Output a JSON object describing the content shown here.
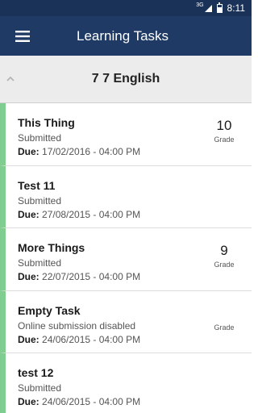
{
  "status_bar": {
    "network": "3G",
    "time": "8:11"
  },
  "app_bar": {
    "title": "Learning Tasks",
    "menu_icon": "hamburger-menu-icon"
  },
  "course": {
    "title": "7 7 English",
    "collapse_icon": "chevron-up-icon"
  },
  "accent_color": "#7fce8f",
  "header_color": "#1f3a64",
  "tasks": [
    {
      "name": "This Thing",
      "status": "Submitted",
      "due_label": "Due:",
      "due": "17/02/2016 - 04:00 PM",
      "grade": "10",
      "grade_label": "Grade"
    },
    {
      "name": "Test 11",
      "status": "Submitted",
      "due_label": "Due:",
      "due": "27/08/2015 - 04:00 PM",
      "grade": "",
      "grade_label": ""
    },
    {
      "name": "More Things",
      "status": "Submitted",
      "due_label": "Due:",
      "due": "22/07/2015 - 04:00 PM",
      "grade": "9",
      "grade_label": "Grade"
    },
    {
      "name": "Empty Task",
      "status": "Online submission disabled",
      "due_label": "Due:",
      "due": "24/06/2015 - 04:00 PM",
      "grade": "",
      "grade_label": "Grade"
    },
    {
      "name": "test 12",
      "status": "Submitted",
      "due_label": "Due:",
      "due": "24/06/2015 - 04:00 PM",
      "grade": "",
      "grade_label": ""
    }
  ]
}
